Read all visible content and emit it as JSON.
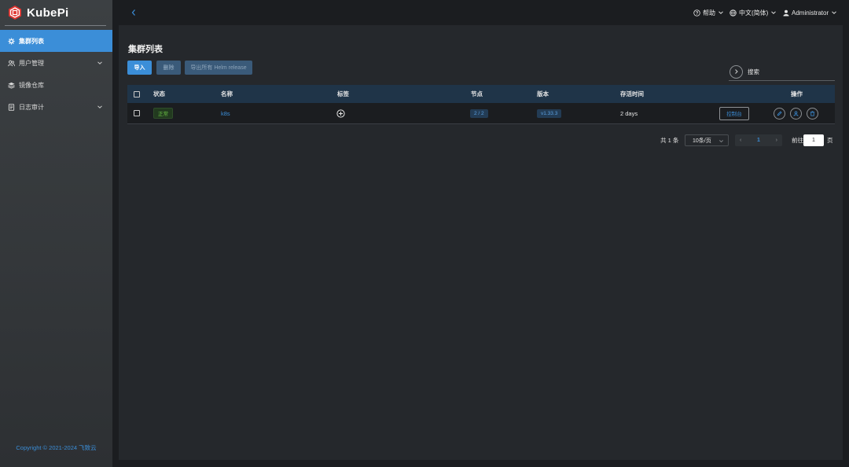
{
  "app": {
    "logo_text": "KubePi"
  },
  "sidebar": {
    "items": [
      {
        "label": "集群列表",
        "active": true,
        "icon": "gear-icon"
      },
      {
        "label": "用户管理",
        "active": false,
        "icon": "users-icon",
        "has_children": true
      },
      {
        "label": "镜像仓库",
        "active": false,
        "icon": "stack-icon"
      },
      {
        "label": "日志审计",
        "active": false,
        "icon": "document-icon",
        "has_children": true
      }
    ],
    "copyright": "Copyright © 2021-2024 飞致云"
  },
  "header": {
    "help_label": "帮助",
    "language_label": "中文(简体)",
    "user_label": "Administrator"
  },
  "page": {
    "title": "集群列表",
    "buttons": {
      "import": "导入",
      "delete": "删除",
      "export": "导出所有 Helm release"
    },
    "search_placeholder": "搜索"
  },
  "table": {
    "columns": {
      "status": "状态",
      "name": "名称",
      "labels": "标签",
      "nodes": "节点",
      "version": "版本",
      "age": "存活时间",
      "actions": "操作"
    },
    "rows": [
      {
        "status": "正常",
        "name": "k8s",
        "nodes": "2 / 2",
        "version": "v1.33.3",
        "age": "2 days",
        "console_label": "控制台"
      }
    ]
  },
  "pagination": {
    "total": "共 1 条",
    "page_size": "10条/页",
    "prev": "‹",
    "current_page": "1",
    "next": "›",
    "goto_label": "前往",
    "goto_value": "1",
    "page_suffix": "页"
  },
  "colors": {
    "accent": "#3b8ed8",
    "success": "#6ac245",
    "table_header": "#1f3448"
  }
}
